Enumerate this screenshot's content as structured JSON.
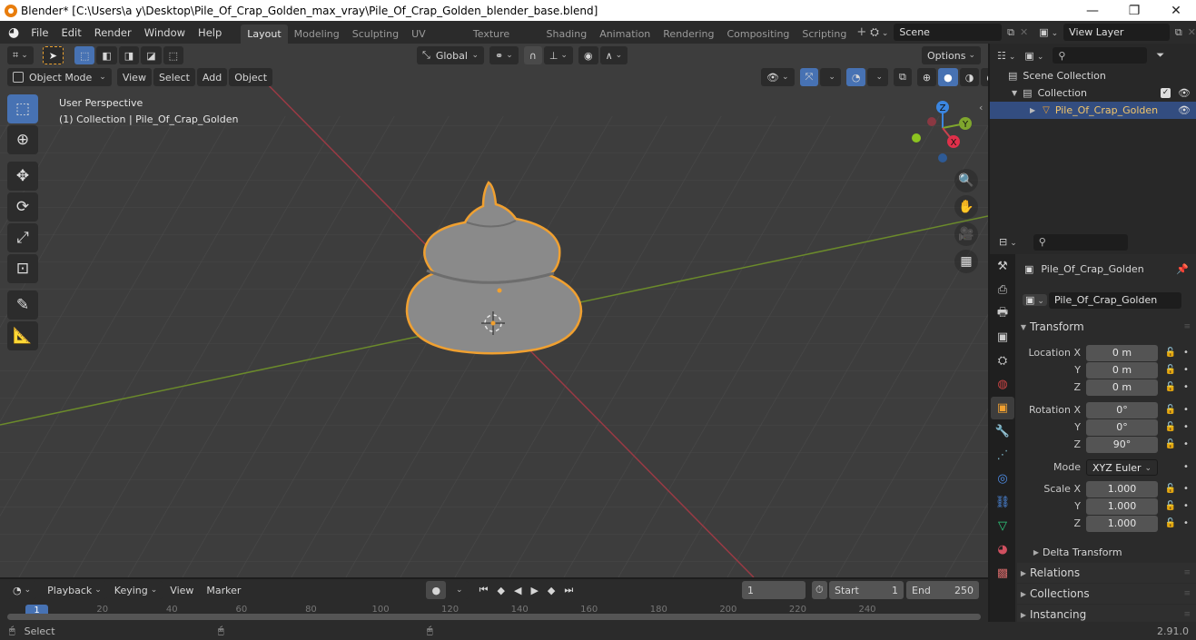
{
  "window": {
    "title": "Blender* [C:\\Users\\a y\\Desktop\\Pile_Of_Crap_Golden_max_vray\\Pile_Of_Crap_Golden_blender_base.blend]",
    "minimize_icon": "minimize-icon",
    "maximize_icon": "restore-icon",
    "close_icon": "close-icon"
  },
  "menubar": {
    "menus": [
      "File",
      "Edit",
      "Render",
      "Window",
      "Help"
    ],
    "workspaces": [
      "Layout",
      "Modeling",
      "Sculpting",
      "UV Editing",
      "Texture Paint",
      "Shading",
      "Animation",
      "Rendering",
      "Compositing",
      "Scripting"
    ],
    "active_workspace": "Layout",
    "add_workspace": "+",
    "scene": "Scene",
    "view_layer": "View Layer"
  },
  "viewport": {
    "header": {
      "transform_orientation": "Global",
      "options_label": "Options"
    },
    "header2": {
      "mode": "Object Mode",
      "menus": [
        "View",
        "Select",
        "Add",
        "Object"
      ]
    },
    "overlay_text": {
      "perspective": "User Perspective",
      "collection_info": "(1) Collection | Pile_Of_Crap_Golden"
    },
    "gizmo": {
      "x": "X",
      "y": "Y",
      "z": "Z"
    },
    "tools": [
      "select-box",
      "cursor",
      "move",
      "rotate",
      "scale",
      "transform",
      "annotate",
      "measure"
    ],
    "nav_buttons": [
      "zoom",
      "pan",
      "camera",
      "ortho-grid"
    ],
    "colors": {
      "x_axis": "#c9424e",
      "y_axis": "#7fa62d",
      "z_axis": "#3b86e0",
      "selection_outline": "#f0a030",
      "active_tool": "#4772b3"
    }
  },
  "outliner": {
    "search_placeholder": "",
    "items": [
      {
        "label": "Scene Collection",
        "level": 0
      },
      {
        "label": "Collection",
        "level": 1,
        "checked": true
      },
      {
        "label": "Pile_Of_Crap_Golden",
        "level": 2,
        "selected": true
      }
    ]
  },
  "properties": {
    "search_placeholder": "",
    "object_name_header": "Pile_Of_Crap_Golden",
    "object_name_field": "Pile_Of_Crap_Golden",
    "transform_label": "Transform",
    "location": {
      "label": "Location X",
      "x": "0 m",
      "y": "0 m",
      "z": "0 m"
    },
    "rotation": {
      "label": "Rotation X",
      "x": "0°",
      "y": "0°",
      "z": "90°"
    },
    "mode_label": "Mode",
    "mode_value": "XYZ Euler",
    "scale": {
      "label": "Scale X",
      "x": "1.000",
      "y": "1.000",
      "z": "1.000"
    },
    "axis_y": "Y",
    "axis_z": "Z",
    "subpanels": [
      "Delta Transform"
    ],
    "panels": [
      "Relations",
      "Collections",
      "Instancing"
    ]
  },
  "timeline": {
    "menus": [
      "Playback",
      "Keying",
      "View",
      "Marker"
    ],
    "current_frame": "1",
    "start_label": "Start",
    "start_value": "1",
    "end_label": "End",
    "end_value": "250",
    "ruler": [
      "1",
      "20",
      "40",
      "60",
      "80",
      "100",
      "120",
      "140",
      "160",
      "180",
      "200",
      "220",
      "240"
    ]
  },
  "statusbar": {
    "select_label": "Select",
    "version": "2.91.0"
  }
}
